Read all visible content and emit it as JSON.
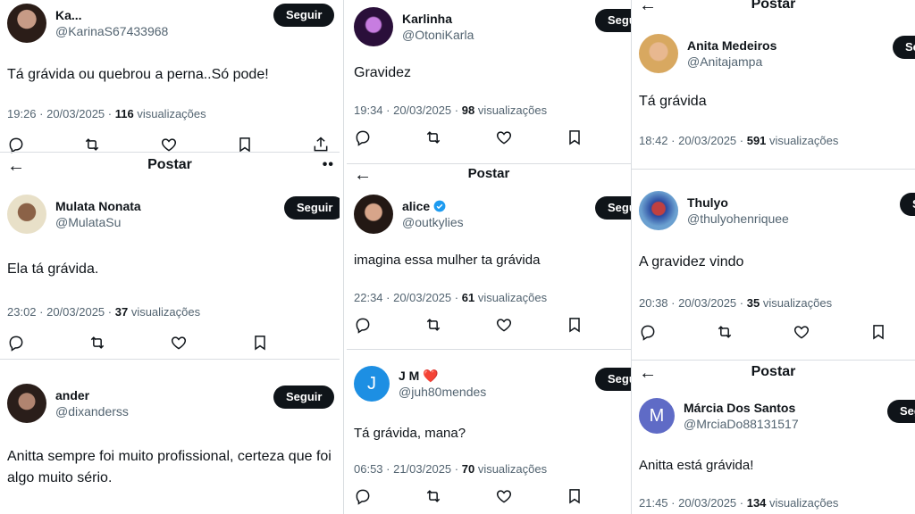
{
  "common": {
    "follow_label": "Seguir",
    "post_title": "Postar",
    "views_word": "visualizações"
  },
  "tweets": [
    {
      "name": "Ka...",
      "handle": "@KarinaS67433968",
      "text": "Tá grávida ou quebrou a perna..Só pode!",
      "time": "19:26 · 20/03/2025 ·",
      "views": "116"
    },
    {
      "name": "Mulata Nonata",
      "handle": "@MulataSu",
      "text": "Ela tá grávida.",
      "time": "23:02 · 20/03/2025 ·",
      "views": "37"
    },
    {
      "name": "ander",
      "handle": "@dixanderss",
      "text": "Anitta sempre foi muito profissional, certeza que foi algo muito sério."
    },
    {
      "name": "Karlinha",
      "handle": "@OtoniKarla",
      "text": "Gravidez",
      "time": "19:34 · 20/03/2025 ·",
      "views": "98"
    },
    {
      "name": "alice",
      "handle": "@outkylies",
      "text": "imagina essa mulher ta grávida",
      "time": "22:34 · 20/03/2025 ·",
      "views": "61"
    },
    {
      "name": "J M ❤️",
      "handle": "@juh80mendes",
      "text": "Tá grávida, mana?",
      "time": "06:53 · 21/03/2025 ·",
      "views": "70",
      "avatar_letter": "J"
    },
    {
      "name": "Anita Medeiros",
      "handle": "@Anitajampa",
      "text": "Tá grávida",
      "time": "18:42 · 20/03/2025 ·",
      "views": "591"
    },
    {
      "name": "Thulyo",
      "handle": "@thulyohenriquee",
      "text": "A gravidez vindo",
      "time": "20:38 · 20/03/2025 ·",
      "views": "35"
    },
    {
      "name": "Márcia Dos Santos",
      "handle": "@MrciaDo88131517",
      "text": "Anitta está grávida!",
      "time": "21:45 · 20/03/2025 ·",
      "views": "134",
      "avatar_letter": "M"
    }
  ],
  "colors": {
    "follow_bg": "#0f1419",
    "verified": "#1d9bf0",
    "jm_avatar": "#1d8fe3",
    "marcia_avatar": "#5f6bc6"
  }
}
